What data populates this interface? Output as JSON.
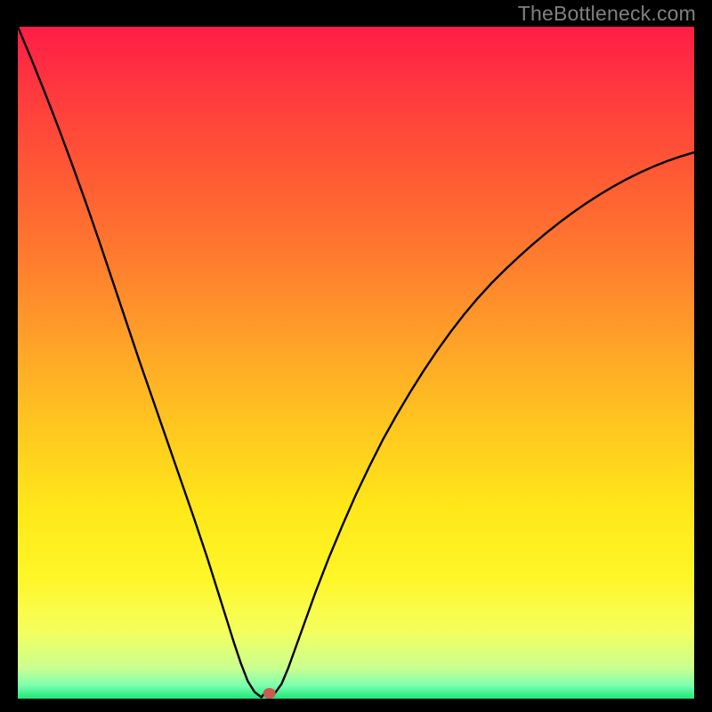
{
  "watermark": "TheBottleneck.com",
  "chart_data": {
    "type": "line",
    "title": "",
    "xlabel": "",
    "ylabel": "",
    "xlim": [
      0,
      100
    ],
    "ylim": [
      0,
      100
    ],
    "grid": false,
    "x": [
      0,
      2,
      4,
      6,
      8,
      10,
      12,
      14,
      16,
      18,
      20,
      22,
      24,
      26,
      28,
      30,
      31,
      32,
      33,
      34,
      35,
      36,
      36.5,
      37,
      37.5,
      38,
      39,
      40,
      41,
      42,
      43,
      44,
      46,
      48,
      50,
      52,
      54,
      56,
      58,
      60,
      62,
      64,
      66,
      68,
      70,
      72,
      74,
      76,
      78,
      80,
      82,
      84,
      86,
      88,
      90,
      92,
      94,
      96,
      98,
      100
    ],
    "y": [
      100,
      95.2,
      90.2,
      85.0,
      79.6,
      74.0,
      68.2,
      62.2,
      56.2,
      50.2,
      44.4,
      38.6,
      32.8,
      27.0,
      21.0,
      14.6,
      11.4,
      8.2,
      5.2,
      2.6,
      1.0,
      0.2,
      0.8,
      0.8,
      0.8,
      0.8,
      2.2,
      4.6,
      7.4,
      10.2,
      13.0,
      15.8,
      21.0,
      25.8,
      30.4,
      34.6,
      38.6,
      42.2,
      45.6,
      48.8,
      51.8,
      54.6,
      57.2,
      59.6,
      61.8,
      63.8,
      65.7,
      67.5,
      69.2,
      70.8,
      72.3,
      73.7,
      75.0,
      76.2,
      77.3,
      78.3,
      79.2,
      80.0,
      80.7,
      81.3
    ],
    "marker": {
      "x": 37.2,
      "y": 0.8
    },
    "background_gradient": [
      {
        "offset": 0.0,
        "color": "#ff1d46"
      },
      {
        "offset": 0.1,
        "color": "#ff3a3e"
      },
      {
        "offset": 0.22,
        "color": "#ff5a34"
      },
      {
        "offset": 0.35,
        "color": "#ff7d2e"
      },
      {
        "offset": 0.48,
        "color": "#ffa528"
      },
      {
        "offset": 0.6,
        "color": "#ffc81f"
      },
      {
        "offset": 0.72,
        "color": "#ffe81a"
      },
      {
        "offset": 0.82,
        "color": "#fff628"
      },
      {
        "offset": 0.9,
        "color": "#f4ff5e"
      },
      {
        "offset": 0.955,
        "color": "#c9ff90"
      },
      {
        "offset": 0.98,
        "color": "#7dffb0"
      },
      {
        "offset": 1.0,
        "color": "#1de777"
      }
    ]
  }
}
